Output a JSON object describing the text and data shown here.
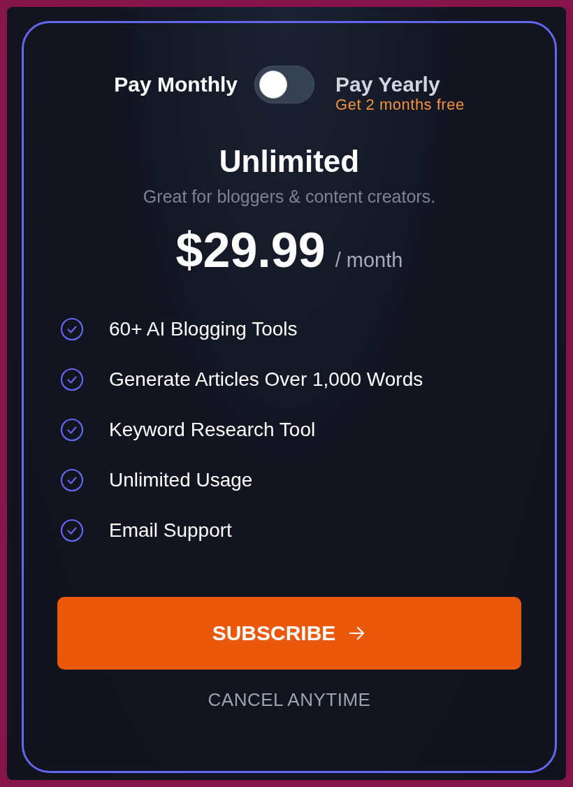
{
  "billing_toggle": {
    "left_label": "Pay Monthly",
    "right_label": "Pay Yearly",
    "right_note": "Get 2 months free",
    "on": false
  },
  "plan": {
    "name": "Unlimited",
    "tagline": "Great for bloggers & content creators.",
    "price": "$29.99",
    "period": "/ month"
  },
  "features": [
    {
      "label": "60+ AI Blogging Tools",
      "included": true
    },
    {
      "label": "Generate Articles Over 1,000 Words",
      "included": true
    },
    {
      "label": "Keyword Research Tool",
      "included": true
    },
    {
      "label": "Unlimited Usage",
      "included": true
    },
    {
      "label": "Email Support",
      "included": true
    }
  ],
  "subscribe_button": {
    "label": "SUBSCRIBE"
  },
  "footnote": "CANCEL ANYTIME"
}
